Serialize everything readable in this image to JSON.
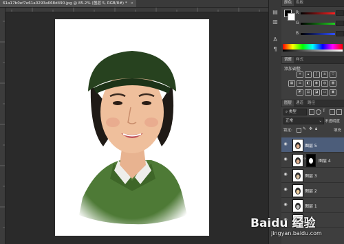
{
  "tabbar": {
    "doc_tab_label": "61a17b0ef7e61a0293a668d490.jpg @ 85.2% (图层 5, RGB/8#) *"
  },
  "panels": {
    "color": {
      "tab_color": "颜色",
      "tab_swatches": "色板",
      "r_label": "R",
      "g_label": "G",
      "b_label": "B"
    },
    "adjustments": {
      "tab_adjustments": "调整",
      "tab_styles": "样式",
      "title": "添加调整"
    },
    "layers": {
      "tab_layers": "图层",
      "tab_channels": "通道",
      "tab_paths": "路径",
      "filter_kind": "类型",
      "blend_mode": "正常",
      "opacity_label": "不透明度",
      "lock_label": "锁定:",
      "fill_label": "填充",
      "items": [
        {
          "name": "图层 5",
          "selected": true,
          "has_mask": false
        },
        {
          "name": "图层 4",
          "selected": false,
          "has_mask": true
        },
        {
          "name": "图层 3",
          "selected": false,
          "has_mask": false
        },
        {
          "name": "图层 2",
          "selected": false,
          "has_mask": false
        },
        {
          "name": "图层 1",
          "selected": false,
          "has_mask": false
        }
      ]
    }
  },
  "watermark": {
    "brand": "Baidu 经验",
    "url": "jingyan.baidu.com"
  },
  "colors": {
    "app_background": "#282828",
    "panel_background": "#3e3e3e",
    "selected_layer": "#4c5d7a",
    "slider_red": "#c83030",
    "slider_green": "#30a030",
    "slider_blue": "#3050c8"
  }
}
